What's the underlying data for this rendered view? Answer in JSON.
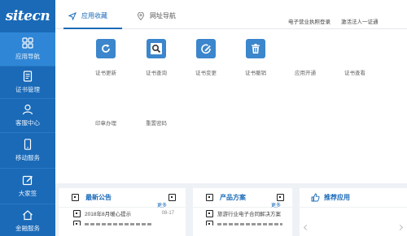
{
  "logo": {
    "text": "sitecn"
  },
  "sidebar": {
    "items": [
      {
        "label": "应用导航",
        "icon": "grid-icon"
      },
      {
        "label": "证书管理",
        "icon": "document-icon"
      },
      {
        "label": "客服中心",
        "icon": "user-icon"
      },
      {
        "label": "移动服务",
        "icon": "mobile-icon"
      },
      {
        "label": "大家签",
        "icon": "edit-icon"
      },
      {
        "label": "金融服务",
        "icon": "home-icon"
      }
    ]
  },
  "topbar": {
    "tabs": [
      {
        "label": "应用收藏",
        "icon": "send-icon"
      },
      {
        "label": "网址导航",
        "icon": "location-icon"
      }
    ],
    "links": [
      "电子营业执照登录",
      "激活法人一证通"
    ]
  },
  "apps": [
    {
      "label": "证书更新",
      "icon": "refresh-icon"
    },
    {
      "label": "证书查询",
      "icon": "search-icon"
    },
    {
      "label": "证书变更",
      "icon": "pencil-icon"
    },
    {
      "label": "证书撤销",
      "icon": "trash-icon"
    },
    {
      "label": "应用开通",
      "icon": "none"
    },
    {
      "label": "证书查看",
      "icon": "none"
    },
    {
      "label": "印章办理",
      "icon": "none"
    },
    {
      "label": "重置密码",
      "icon": "none"
    }
  ],
  "cards": {
    "announcements": {
      "title": "最新公告",
      "more": "更多",
      "items": [
        {
          "text": "2018年8月暖心提示",
          "date": "08-17"
        }
      ]
    },
    "products": {
      "title": "产品方案",
      "more": "更多",
      "items": [
        {
          "text": "旅游行业电子合同解决方案"
        }
      ]
    },
    "recommend": {
      "title": "推荐应用"
    }
  },
  "colors": {
    "primary": "#1a6ab8",
    "active_nav": "#2f86d6",
    "icon_blue": "#3b86cc"
  }
}
